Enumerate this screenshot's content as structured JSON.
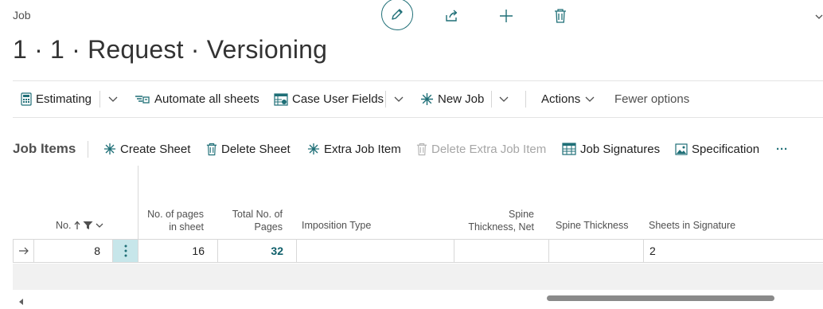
{
  "page": {
    "caption": "Job",
    "title": "1 · 1 · Request · Versioning"
  },
  "header_icons": [
    "edit-icon",
    "share-icon",
    "plus-icon",
    "trash-icon",
    "chevron-down-icon"
  ],
  "actionbar": {
    "estimating": "Estimating",
    "automate": "Automate all sheets",
    "case_fields": "Case User Fields",
    "new_job": "New Job",
    "actions": "Actions",
    "fewer": "Fewer options"
  },
  "subbar": {
    "title": "Job Items",
    "create_sheet": "Create Sheet",
    "delete_sheet": "Delete Sheet",
    "extra_item": "Extra Job Item",
    "delete_extra": "Delete Extra Job Item",
    "signatures": "Job Signatures",
    "specification": "Specification",
    "more": "···"
  },
  "table": {
    "columns": {
      "no": "No.",
      "pages_line1": "No. of pages",
      "pages_line2": "in sheet",
      "total_line1": "Total No. of",
      "total_line2": "Pages",
      "imposition": "Imposition Type",
      "spine_net_line1": "Spine",
      "spine_net_line2": "Thickness, Net",
      "spine": "Spine Thickness",
      "sheets": "Sheets in Signature"
    },
    "row": {
      "no": "8",
      "pages": "16",
      "total": "32",
      "imposition": "",
      "spine_net": "",
      "spine": "",
      "sheets": "2"
    }
  },
  "colors": {
    "accent": "#1f6f77",
    "link": "#0f5f6a",
    "selected_cell": "#c7e6ea"
  }
}
